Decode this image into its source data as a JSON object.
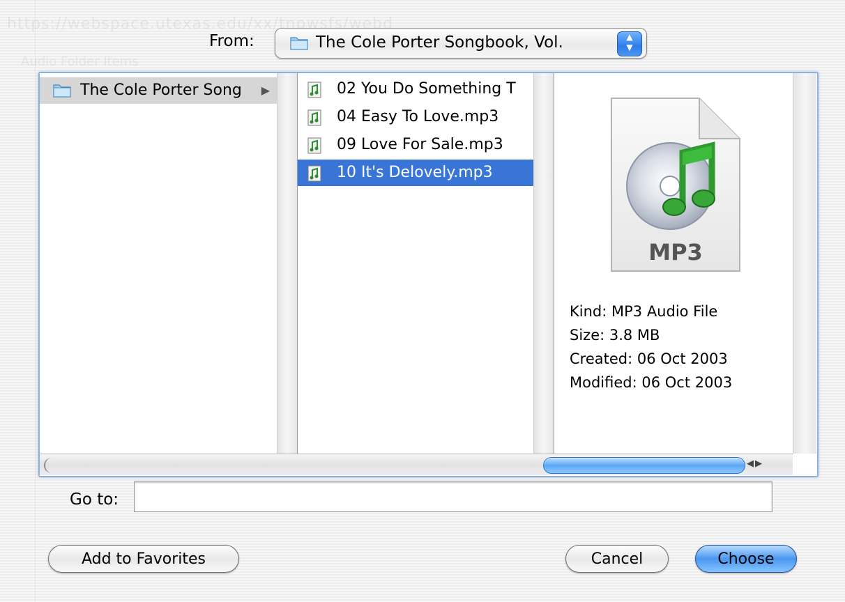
{
  "background": {
    "ghost_url": "https://webspace.utexas.edu/xx/tnpwsfs/webd",
    "ghost_line2": "Audio   Folder   Items"
  },
  "from": {
    "label": "From:",
    "selected": "The Cole Porter Songbook, Vol."
  },
  "columns": {
    "col1": [
      {
        "label": "The Cole Porter Song",
        "icon": "folder-icon",
        "has_children": true
      }
    ],
    "col2": [
      {
        "label": "02 You Do Something T",
        "icon": "mp3-file-icon",
        "selected": false
      },
      {
        "label": "04 Easy To Love.mp3",
        "icon": "mp3-file-icon",
        "selected": false
      },
      {
        "label": "09 Love For Sale.mp3",
        "icon": "mp3-file-icon",
        "selected": false
      },
      {
        "label": "10 It's Delovely.mp3",
        "icon": "mp3-file-icon",
        "selected": true
      }
    ]
  },
  "preview": {
    "badge": "MP3",
    "kind": "Kind: MP3 Audio File",
    "size": "Size: 3.8 MB",
    "created": "Created: 06 Oct 2003",
    "modified": "Modified: 06 Oct 2003"
  },
  "goto": {
    "label": "Go to:",
    "value": ""
  },
  "buttons": {
    "add_favorites": "Add to Favorites",
    "cancel": "Cancel",
    "choose": "Choose"
  },
  "colors": {
    "selection": "#3875d7",
    "accent": "#4a98f0"
  }
}
